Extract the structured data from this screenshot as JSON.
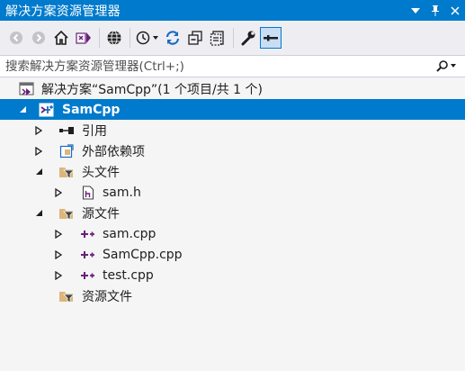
{
  "window": {
    "title": "解决方案资源管理器",
    "controls": [
      "dropdown-icon",
      "pin-icon",
      "close-icon"
    ]
  },
  "toolbar": {
    "buttons": [
      "back-icon",
      "forward-icon",
      "home-icon",
      "switch-views-icon",
      "globe-icon",
      "history-icon",
      "sync-icon",
      "collapse-all-icon",
      "show-all-files-icon",
      "properties-wrench-icon",
      "preview-selected-icon"
    ]
  },
  "search": {
    "placeholder": "搜索解决方案资源管理器(Ctrl+;)"
  },
  "tree": {
    "solution": "解决方案“SamCpp”(1 个项目/共 1 个)",
    "project": "SamCpp",
    "references": "引用",
    "external_dependencies": "外部依赖项",
    "header_files": "头文件",
    "sam_h": "sam.h",
    "source_files": "源文件",
    "sam_cpp": "sam.cpp",
    "samcpp_cpp": "SamCpp.cpp",
    "test_cpp": "test.cpp",
    "resource_files": "资源文件"
  },
  "colors": {
    "accent": "#007acc",
    "toolbar_bg": "#eeeef2",
    "panel_bg": "#f5f5f5",
    "cpp_icon": "#68217a",
    "folder": "#dcb67a"
  }
}
